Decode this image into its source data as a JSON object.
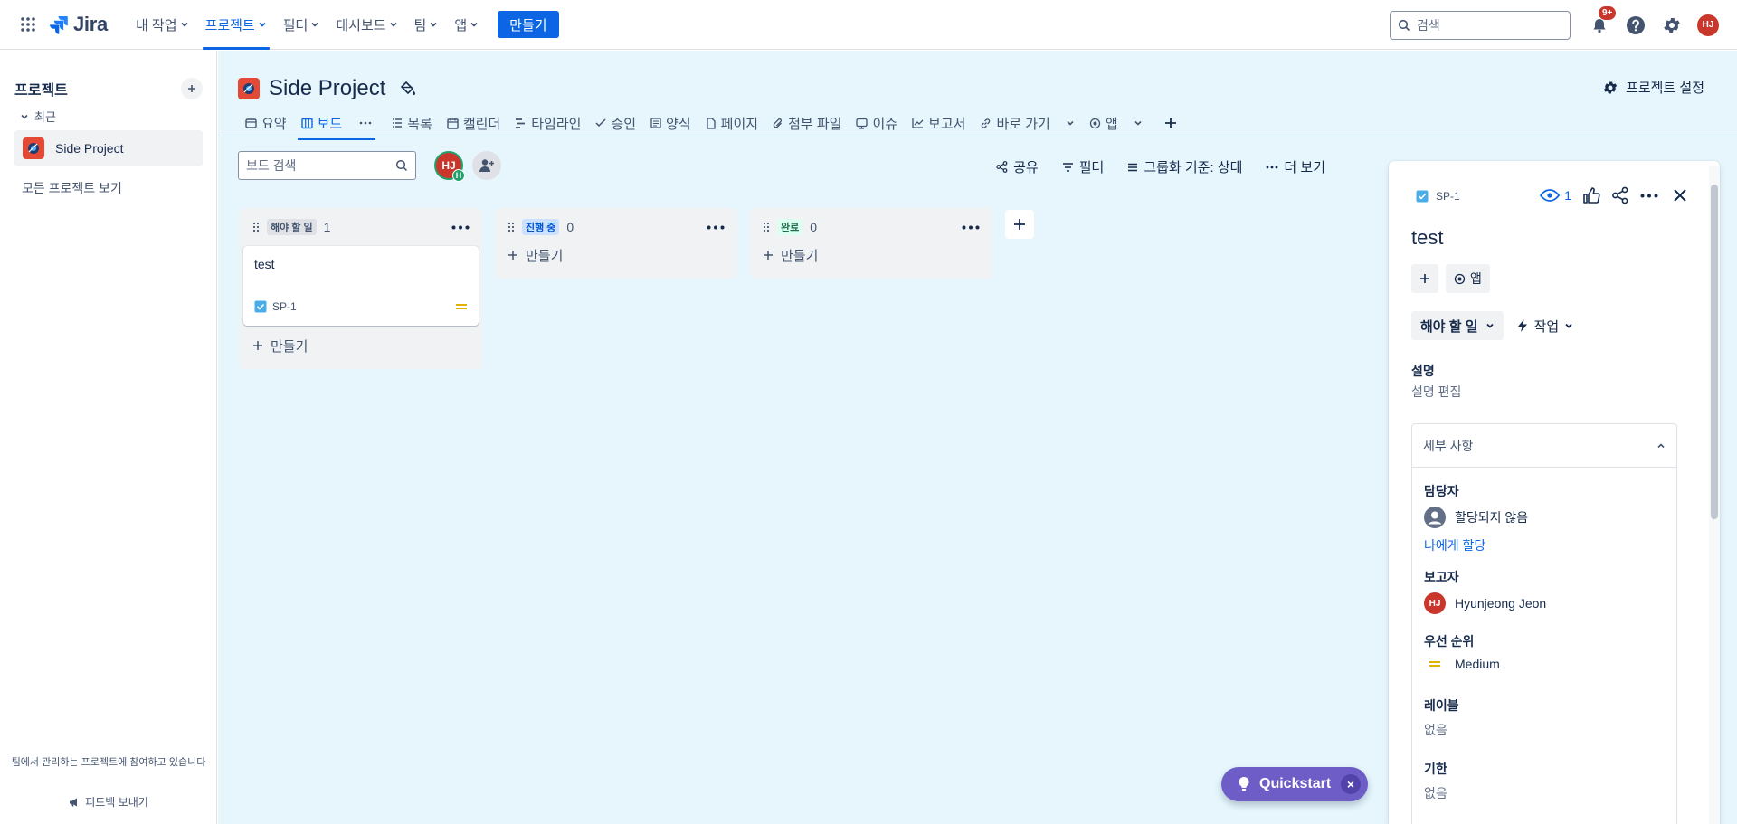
{
  "topnav": {
    "logo_text": "Jira",
    "items": [
      {
        "label": "내 작업"
      },
      {
        "label": "프로젝트",
        "active": true
      },
      {
        "label": "필터"
      },
      {
        "label": "대시보드"
      },
      {
        "label": "팀"
      },
      {
        "label": "앱"
      }
    ],
    "create_label": "만들기",
    "search_placeholder": "검색",
    "notifications_badge": "9+",
    "user_initials": "HJ"
  },
  "sidebar": {
    "title": "프로젝트",
    "recent_label": "최근",
    "project_name": "Side Project",
    "all_projects_label": "모든 프로젝트 보기",
    "footer_note": "팀에서 관리하는 프로젝트에 참여하고 있습니다",
    "feedback_label": "피드백 보내기"
  },
  "project": {
    "name": "Side Project",
    "settings_label": "프로젝트 설정",
    "tabs": [
      {
        "label": "요약",
        "icon": "globe-icon"
      },
      {
        "label": "보드",
        "icon": "board-icon",
        "active": true
      },
      {
        "label": "목록",
        "icon": "list-icon"
      },
      {
        "label": "캘린더",
        "icon": "calendar-icon"
      },
      {
        "label": "타임라인",
        "icon": "timeline-icon"
      },
      {
        "label": "승인",
        "icon": "approval-icon"
      },
      {
        "label": "양식",
        "icon": "form-icon"
      },
      {
        "label": "페이지",
        "icon": "page-icon"
      },
      {
        "label": "첨부 파일",
        "icon": "attachment-icon"
      },
      {
        "label": "이슈",
        "icon": "issue-icon"
      },
      {
        "label": "보고서",
        "icon": "report-icon"
      },
      {
        "label": "바로 가기",
        "icon": "link-icon"
      },
      {
        "label": "앱",
        "icon": "apps-icon"
      }
    ]
  },
  "board": {
    "search_placeholder": "보드 검색",
    "avatar_initials": "HJ",
    "avatar_mini": "H",
    "actions": {
      "share": "공유",
      "filter": "필터",
      "group": "그룹화 기준: 상태",
      "more": "더 보기"
    },
    "create_label": "만들기",
    "columns": [
      {
        "name": "해야 할 일",
        "count": "1",
        "lozenge_bg": "#dfe1e6",
        "lozenge_fg": "#44546f"
      },
      {
        "name": "진행 중",
        "count": "0",
        "lozenge_bg": "#cce0ff",
        "lozenge_fg": "#0055cc"
      },
      {
        "name": "완료",
        "count": "0",
        "lozenge_bg": "#dcfff1",
        "lozenge_fg": "#216e4e"
      }
    ],
    "card": {
      "title": "test",
      "key": "SP-1",
      "priority": "Medium"
    }
  },
  "panel": {
    "key": "SP-1",
    "watch_count": "1",
    "title": "test",
    "apps_label": "앱",
    "status_label": "해야 할 일",
    "work_label": "작업",
    "description_label": "설명",
    "description_placeholder": "설명 편집",
    "details_label": "세부 사항",
    "assignee_label": "담당자",
    "assignee_value": "할당되지 않음",
    "assign_to_me": "나에게 할당",
    "reporter_label": "보고자",
    "reporter_initials": "HJ",
    "reporter_value": "Hyunjeong Jeon",
    "priority_label": "우선 순위",
    "priority_value": "Medium",
    "labels_label": "레이블",
    "labels_value": "없음",
    "due_label": "기한",
    "due_value": "없음"
  },
  "quickstart": {
    "label": "Quickstart",
    "close": "×"
  },
  "colors": {
    "brand_blue": "#0c66e4",
    "board_bg": "#e6f6fc",
    "quickstart": "#6e5dc6",
    "avatar_red": "#c9372c",
    "priority_medium": "#e2b203"
  }
}
